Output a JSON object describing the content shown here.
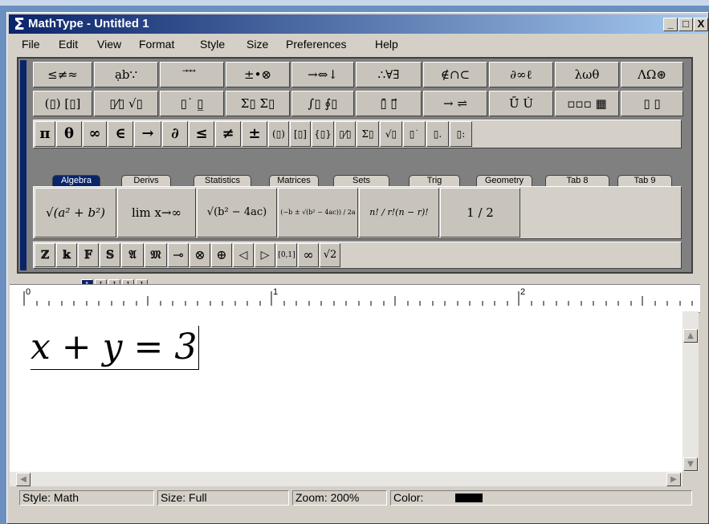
{
  "window": {
    "title": "MathType - Untitled 1",
    "icon": "sigma-icon"
  },
  "title_buttons": {
    "minimize": "_",
    "maximize": "□",
    "close": "X"
  },
  "menu": [
    "File",
    "Edit",
    "View",
    "Format",
    "Style",
    "Size",
    "Preferences",
    "Help"
  ],
  "palette_row1": [
    "≤≠≈",
    "ạb∵",
    "⃗ ⃗ ⃗",
    "±•⊗",
    "→⇔↓",
    "∴∀∃",
    "∉∩⊂",
    "∂∞ℓ",
    "λωθ",
    "ΛΩ⊛"
  ],
  "palette_row2": [
    "(▯) [▯]",
    "▯⁄▯ √▯",
    "▯˙ ▯̲",
    "Σ▯ Σ▯",
    "∫▯ ∮▯",
    "▯̄ ▯⃗",
    "→ ⇌",
    "Ū̇ U̇",
    "▫▫▫ ▦",
    "▯ ▯"
  ],
  "small_bar": [
    "π",
    "θ",
    "∞",
    "∈",
    "→",
    "∂",
    "≤",
    "≠",
    "±",
    "(▯)",
    "[▯]",
    "{▯}",
    "▯⁄▯",
    "Σ▯",
    "√▯",
    "▯˙",
    "▯.",
    "▯:"
  ],
  "tabs": [
    "Algebra",
    "Derivs",
    "Statistics",
    "Matrices",
    "Sets",
    "Trig",
    "Geometry",
    "Tab 8",
    "Tab 9"
  ],
  "tab_items": [
    "√(a² + b²)",
    "lim x→∞",
    "√(b² − 4ac)",
    "(−b ± √(b² − 4ac)) / 2a",
    "n! / r!(n − r)!",
    "1 / 2"
  ],
  "bottom_bar": [
    "ℤ",
    "𝕜",
    "𝔽",
    "𝕊",
    "𝔄",
    "𝔐",
    "⊸",
    "⊗",
    "⊕",
    "◁",
    "▷",
    "[0,1]",
    "∞",
    "√2"
  ],
  "ruler": {
    "marks": [
      "0",
      "1",
      "2"
    ]
  },
  "size_icons": [
    "t",
    "↑",
    "↑",
    "↑",
    "↑"
  ],
  "equation": "x + y = 3",
  "status": {
    "style": "Style: Math",
    "size": "Size: Full",
    "zoom": "Zoom: 200%",
    "color": "Color:",
    "color_value": "#000000"
  }
}
